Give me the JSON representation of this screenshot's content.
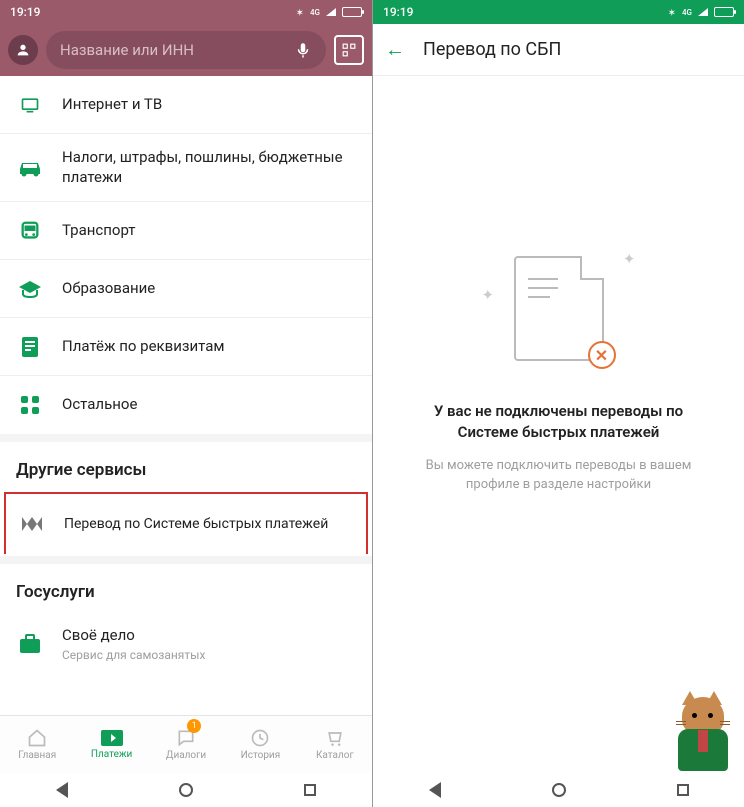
{
  "status": {
    "time": "19:19",
    "network_label": "4G"
  },
  "left": {
    "search_placeholder": "Название или ИНН",
    "rows": [
      {
        "label": "Интернет и ТВ"
      },
      {
        "label": "Налоги, штрафы, пошлины, бюджетные платежи"
      },
      {
        "label": "Транспорт"
      },
      {
        "label": "Образование"
      },
      {
        "label": "Платёж по реквизитам"
      },
      {
        "label": "Остальное"
      }
    ],
    "section_other": "Другие сервисы",
    "sbp_row": "Перевод по Системе быстрых платежей",
    "section_gos": "Госуслуги",
    "gos_row": {
      "label": "Своё дело",
      "sub": "Сервис для самозанятых"
    },
    "nav": [
      {
        "label": "Главная"
      },
      {
        "label": "Платежи"
      },
      {
        "label": "Диалоги",
        "badge": "1"
      },
      {
        "label": "История"
      },
      {
        "label": "Каталог"
      }
    ]
  },
  "right": {
    "title": "Перевод по СБП",
    "empty_title": "У вас не подключены переводы по Системе быстрых платежей",
    "empty_sub": "Вы можете подключить переводы в вашем профиле в разделе настройки"
  }
}
